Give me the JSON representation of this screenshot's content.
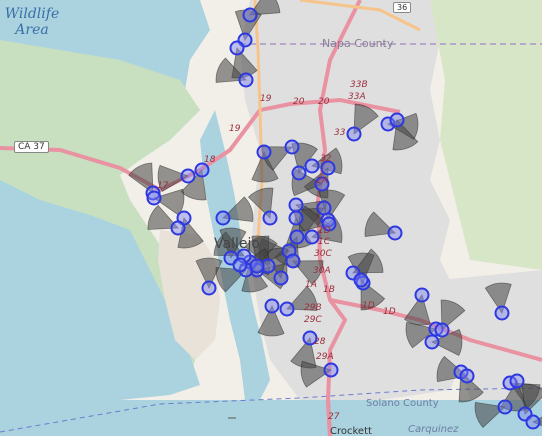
{
  "map": {
    "labels": {
      "wildlife_area": "Wildlife\nArea",
      "napa_county": "Napa County",
      "solano_county": "Solano County",
      "vallejo": "Vallejo",
      "crockett": "Crockett",
      "carquinez": "Carquinez",
      "ca37": "CA 37",
      "hwy36": "36",
      "exits": {
        "e19a": "19",
        "e19b": "19",
        "e20a": "20",
        "e20b": "20",
        "e33b": "33B",
        "e33a": "33A",
        "e33": "33",
        "e32": "32",
        "e2a": "2A",
        "e17": "17",
        "e18": "18",
        "e1d": "1D",
        "e1c": "1C",
        "e30c": "30C",
        "e30a": "30A",
        "e1a": "1A",
        "e1b": "1B",
        "e1d2": "1D",
        "e1d3": "1D",
        "e29b": "29B",
        "e29c": "29C",
        "e28": "28",
        "e29a": "29A",
        "e27": "27"
      }
    },
    "colors": {
      "water": "#aad3df",
      "marsh": "#c8e0c0",
      "urban": "#e0dfdf",
      "motorway": "#e892a2",
      "marker_fill": "#7c83f2",
      "marker_stroke": "#2d38e0",
      "cone_fill": "#444444"
    },
    "cameras": [
      {
        "dir": "east"
      },
      {
        "dir": "north"
      },
      {
        "dir": "south"
      },
      {
        "dir": "west"
      },
      {
        "dir": "south"
      },
      {
        "dir": "west"
      },
      {
        "dir": "north"
      },
      {
        "dir": "east"
      },
      {
        "dir": "south"
      },
      {
        "dir": "west"
      },
      {
        "dir": "north"
      },
      {
        "dir": "east"
      },
      {
        "dir": "south"
      },
      {
        "dir": "west"
      },
      {
        "dir": "north"
      },
      {
        "dir": "east"
      },
      {
        "dir": "south"
      },
      {
        "dir": "west"
      },
      {
        "dir": "north"
      },
      {
        "dir": "east"
      },
      {
        "dir": "south"
      },
      {
        "dir": "west"
      },
      {
        "dir": "north"
      },
      {
        "dir": "east"
      },
      {
        "dir": "south"
      },
      {
        "dir": "west"
      },
      {
        "dir": "north"
      },
      {
        "dir": "east"
      },
      {
        "dir": "south"
      },
      {
        "dir": "west"
      },
      {
        "dir": "north"
      },
      {
        "dir": "east"
      },
      {
        "dir": "south"
      },
      {
        "dir": "west"
      },
      {
        "dir": "north"
      },
      {
        "dir": "east"
      },
      {
        "dir": "south"
      },
      {
        "dir": "west"
      },
      {
        "dir": "north"
      },
      {
        "dir": "east"
      },
      {
        "dir": "south"
      },
      {
        "dir": "west"
      },
      {
        "dir": "north"
      },
      {
        "dir": "east"
      },
      {
        "dir": "south"
      },
      {
        "dir": "west"
      },
      {
        "dir": "north"
      },
      {
        "dir": "east"
      },
      {
        "dir": "south"
      },
      {
        "dir": "west"
      },
      {
        "dir": "north"
      },
      {
        "dir": "east"
      },
      {
        "dir": "south"
      },
      {
        "dir": "west"
      },
      {
        "dir": "north"
      },
      {
        "dir": "east"
      },
      {
        "dir": "south"
      },
      {
        "dir": "west"
      },
      {
        "dir": "north"
      },
      {
        "dir": "east"
      }
    ]
  }
}
